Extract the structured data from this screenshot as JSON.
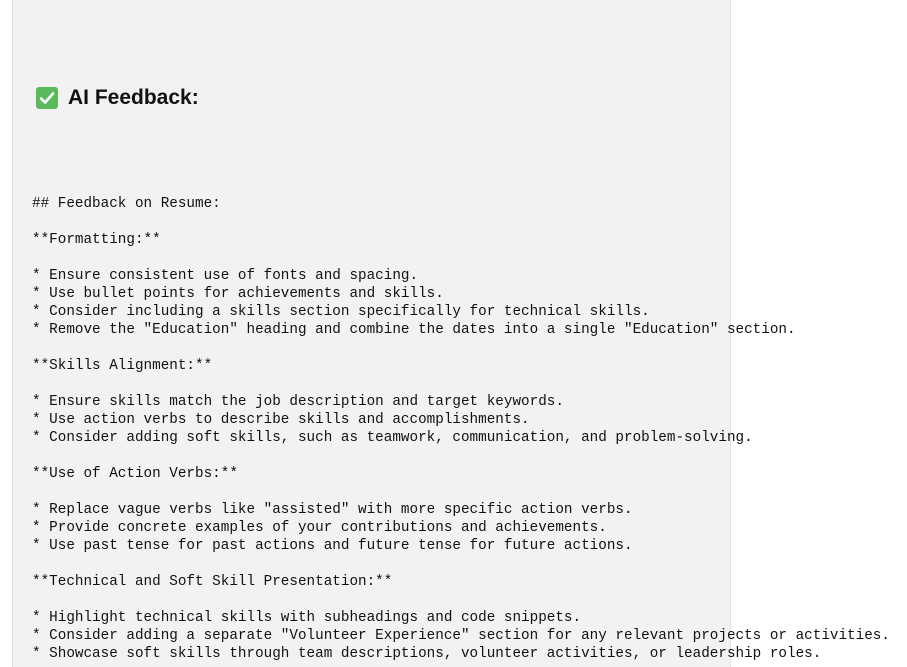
{
  "feedback_panel": {
    "heading": "AI Feedback:",
    "heading_icon": "check-mark-button-icon",
    "accent_color": "#5cb85c"
  },
  "feedback_lines": [
    "## Feedback on Resume:",
    "",
    "**Formatting:**",
    "",
    "* Ensure consistent use of fonts and spacing.",
    "* Use bullet points for achievements and skills.",
    "* Consider including a skills section specifically for technical skills.",
    "* Remove the \"Education\" heading and combine the dates into a single \"Education\" section.",
    "",
    "**Skills Alignment:**",
    "",
    "* Ensure skills match the job description and target keywords.",
    "* Use action verbs to describe skills and accomplishments.",
    "* Consider adding soft skills, such as teamwork, communication, and problem-solving.",
    "",
    "**Use of Action Verbs:**",
    "",
    "* Replace vague verbs like \"assisted\" with more specific action verbs.",
    "* Provide concrete examples of your contributions and achievements.",
    "* Use past tense for past actions and future tense for future actions.",
    "",
    "**Technical and Soft Skill Presentation:**",
    "",
    "* Highlight technical skills with subheadings and code snippets.",
    "* Consider adding a separate \"Volunteer Experience\" section for any relevant projects or activities.",
    "* Showcase soft skills through team descriptions, volunteer activities, or leadership roles."
  ]
}
